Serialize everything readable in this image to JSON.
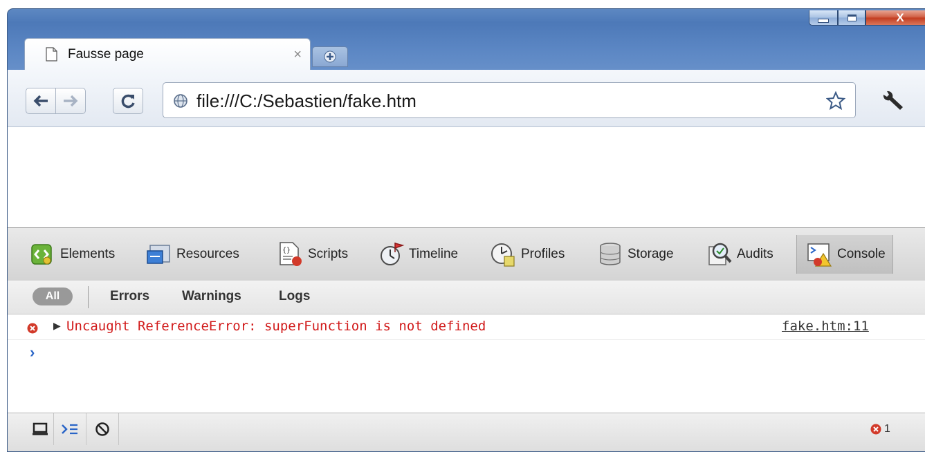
{
  "window": {
    "caption_close_label": "X"
  },
  "tab": {
    "title": "Fausse page",
    "close_label": "×"
  },
  "toolbar": {
    "url": "file:///C:/Sebastien/fake.htm"
  },
  "devtools": {
    "tabs": [
      {
        "label": "Elements",
        "icon": "elements-icon"
      },
      {
        "label": "Resources",
        "icon": "resources-icon"
      },
      {
        "label": "Scripts",
        "icon": "scripts-icon"
      },
      {
        "label": "Timeline",
        "icon": "timeline-icon"
      },
      {
        "label": "Profiles",
        "icon": "profiles-icon"
      },
      {
        "label": "Storage",
        "icon": "storage-icon"
      },
      {
        "label": "Audits",
        "icon": "audits-icon"
      },
      {
        "label": "Console",
        "icon": "console-icon",
        "active": true
      }
    ],
    "filters": {
      "all": "All",
      "errors": "Errors",
      "warnings": "Warnings",
      "logs": "Logs"
    },
    "console": {
      "messages": [
        {
          "level": "error",
          "text": "Uncaught ReferenceError: superFunction is not defined",
          "source": "fake.htm:11"
        }
      ],
      "prompt": "›"
    },
    "status": {
      "error_count": "1"
    }
  },
  "colors": {
    "frame": "#5c87c4",
    "error_text": "#d11a1a",
    "prompt": "#2a65c7"
  }
}
